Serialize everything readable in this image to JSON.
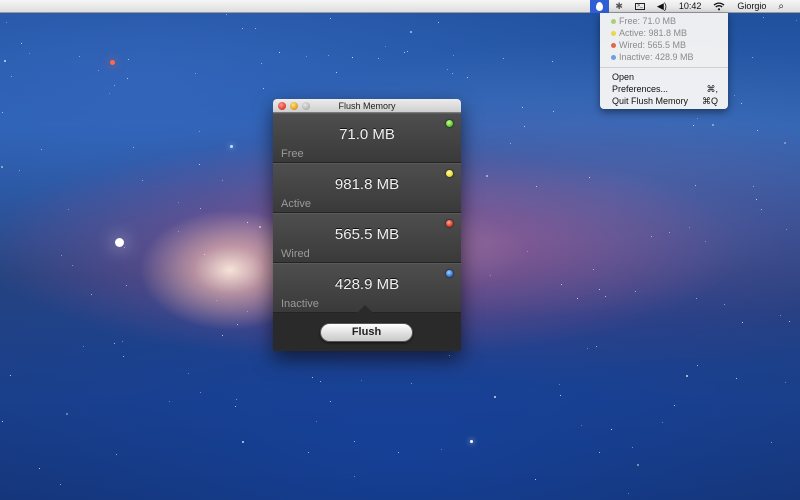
{
  "menubar": {
    "clock": "10:42",
    "user": "Giorgio"
  },
  "dropdown": {
    "stats": [
      {
        "label": "Free: 71.0 MB",
        "color": "#8bc34a"
      },
      {
        "label": "Active: 981.8 MB",
        "color": "#e8d84a"
      },
      {
        "label": "Wired: 565.5 MB",
        "color": "#e0664e"
      },
      {
        "label": "Inactive: 428.9 MB",
        "color": "#4a8fe0"
      }
    ],
    "open_label": "Open",
    "preferences_label": "Preferences...",
    "preferences_shortcut": "⌘,",
    "quit_label": "Quit Flush Memory",
    "quit_shortcut": "⌘Q"
  },
  "window": {
    "title": "Flush Memory",
    "panels": [
      {
        "value": "71.0 MB",
        "label": "Free",
        "led_color": "#5fd32a"
      },
      {
        "value": "981.8 MB",
        "label": "Active",
        "led_color": "#f0e030"
      },
      {
        "value": "565.5 MB",
        "label": "Wired",
        "led_color": "#e83a26"
      },
      {
        "value": "428.9 MB",
        "label": "Inactive",
        "led_color": "#2f7fe8"
      }
    ],
    "flush_label": "Flush"
  }
}
